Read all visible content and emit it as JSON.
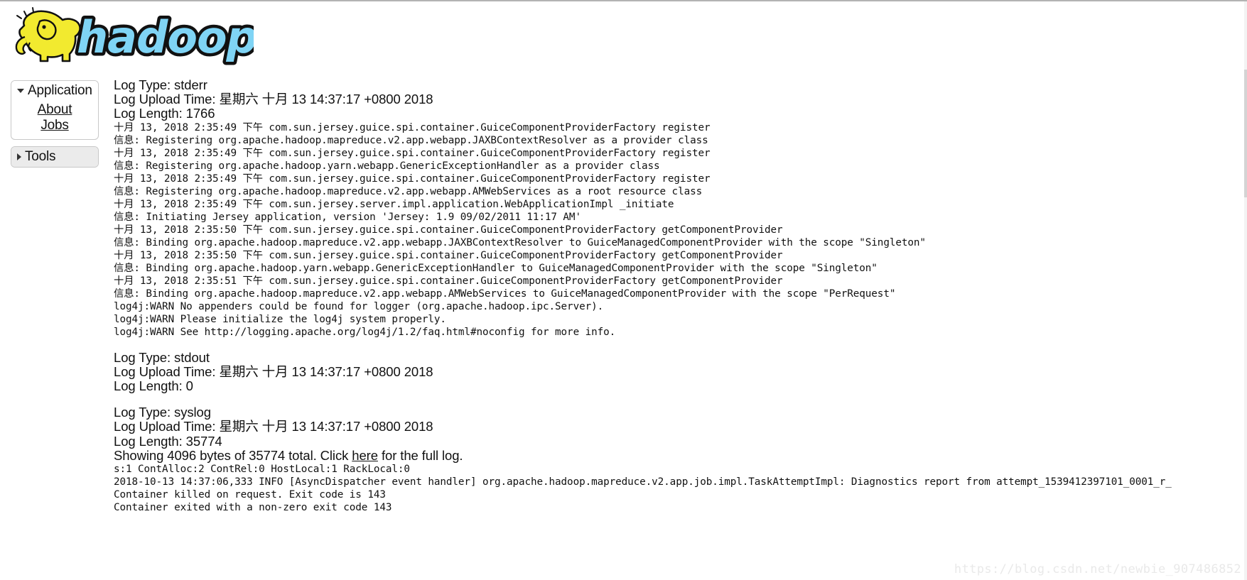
{
  "logo": {
    "alt_text": "hadoop",
    "yellow": "#f2ea2f",
    "blue": "#7fd4f5"
  },
  "sidebar": {
    "application": {
      "label": "Application",
      "expanded": true,
      "toggle_icon": "chevron-down-icon",
      "links": [
        {
          "label": "About"
        },
        {
          "label": "Jobs"
        }
      ]
    },
    "tools": {
      "label": "Tools",
      "expanded": false,
      "toggle_icon": "chevron-right-icon"
    }
  },
  "logs": [
    {
      "type_label": "Log Type: stderr",
      "upload_time_label": "Log Upload Time: 星期六 十月 13 14:37:17 +0800 2018",
      "length_label": "Log Length: 1766",
      "body": [
        "十月 13, 2018 2:35:49 下午 com.sun.jersey.guice.spi.container.GuiceComponentProviderFactory register",
        "信息: Registering org.apache.hadoop.mapreduce.v2.app.webapp.JAXBContextResolver as a provider class",
        "十月 13, 2018 2:35:49 下午 com.sun.jersey.guice.spi.container.GuiceComponentProviderFactory register",
        "信息: Registering org.apache.hadoop.yarn.webapp.GenericExceptionHandler as a provider class",
        "十月 13, 2018 2:35:49 下午 com.sun.jersey.guice.spi.container.GuiceComponentProviderFactory register",
        "信息: Registering org.apache.hadoop.mapreduce.v2.app.webapp.AMWebServices as a root resource class",
        "十月 13, 2018 2:35:49 下午 com.sun.jersey.server.impl.application.WebApplicationImpl _initiate",
        "信息: Initiating Jersey application, version 'Jersey: 1.9 09/02/2011 11:17 AM'",
        "十月 13, 2018 2:35:50 下午 com.sun.jersey.guice.spi.container.GuiceComponentProviderFactory getComponentProvider",
        "信息: Binding org.apache.hadoop.mapreduce.v2.app.webapp.JAXBContextResolver to GuiceManagedComponentProvider with the scope \"Singleton\"",
        "十月 13, 2018 2:35:50 下午 com.sun.jersey.guice.spi.container.GuiceComponentProviderFactory getComponentProvider",
        "信息: Binding org.apache.hadoop.yarn.webapp.GenericExceptionHandler to GuiceManagedComponentProvider with the scope \"Singleton\"",
        "十月 13, 2018 2:35:51 下午 com.sun.jersey.guice.spi.container.GuiceComponentProviderFactory getComponentProvider",
        "信息: Binding org.apache.hadoop.mapreduce.v2.app.webapp.AMWebServices to GuiceManagedComponentProvider with the scope \"PerRequest\"",
        "log4j:WARN No appenders could be found for logger (org.apache.hadoop.ipc.Server).",
        "log4j:WARN Please initialize the log4j system properly.",
        "log4j:WARN See http://logging.apache.org/log4j/1.2/faq.html#noconfig for more info."
      ]
    },
    {
      "type_label": "Log Type: stdout",
      "upload_time_label": "Log Upload Time: 星期六 十月 13 14:37:17 +0800 2018",
      "length_label": "Log Length: 0",
      "body": []
    },
    {
      "type_label": "Log Type: syslog",
      "upload_time_label": "Log Upload Time: 星期六 十月 13 14:37:17 +0800 2018",
      "length_label": "Log Length: 35774",
      "showing": {
        "prefix": "Showing 4096 bytes of 35774 total. Click ",
        "link_label": "here",
        "suffix": " for the full log."
      },
      "body": [
        "s:1 ContAlloc:2 ContRel:0 HostLocal:1 RackLocal:0",
        "2018-10-13 14:37:06,333 INFO [AsyncDispatcher event handler] org.apache.hadoop.mapreduce.v2.app.job.impl.TaskAttemptImpl: Diagnostics report from attempt_1539412397101_0001_r_",
        "Container killed on request. Exit code is 143",
        "Container exited with a non-zero exit code 143"
      ]
    }
  ],
  "watermark": {
    "text": "https://blog.csdn.net/newbie_907486852"
  }
}
